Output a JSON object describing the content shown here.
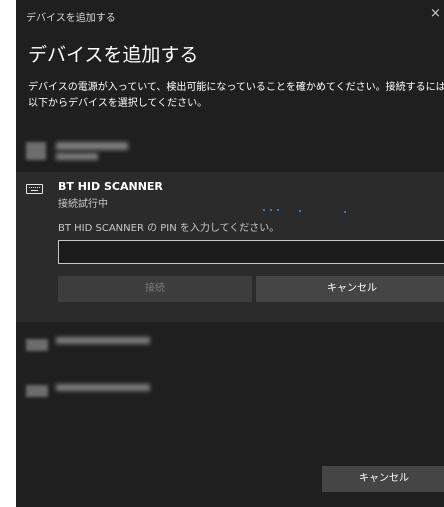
{
  "window": {
    "title": "デバイスを追加する",
    "close_glyph": "×"
  },
  "heading": "デバイスを追加する",
  "description_line1": "デバイスの電源が入っていて、検出可能になっていることを確かめてください。接続するには、",
  "description_line2": "以下からデバイスを選択してください。",
  "device": {
    "icon": "keyboard-icon",
    "name": "BT HID SCANNER",
    "status": "接続試行中",
    "pin_prompt": "BT HID SCANNER の PIN を入力してください。",
    "pin_value": "",
    "connect_label": "接続",
    "cancel_label": "キャンセル"
  },
  "footer": {
    "cancel_label": "キャンセル"
  },
  "colors": {
    "window_bg": "#1f1f1f",
    "panel_bg": "#2b2b2b",
    "button_bg": "#454545",
    "accent": "#4a90e2"
  }
}
